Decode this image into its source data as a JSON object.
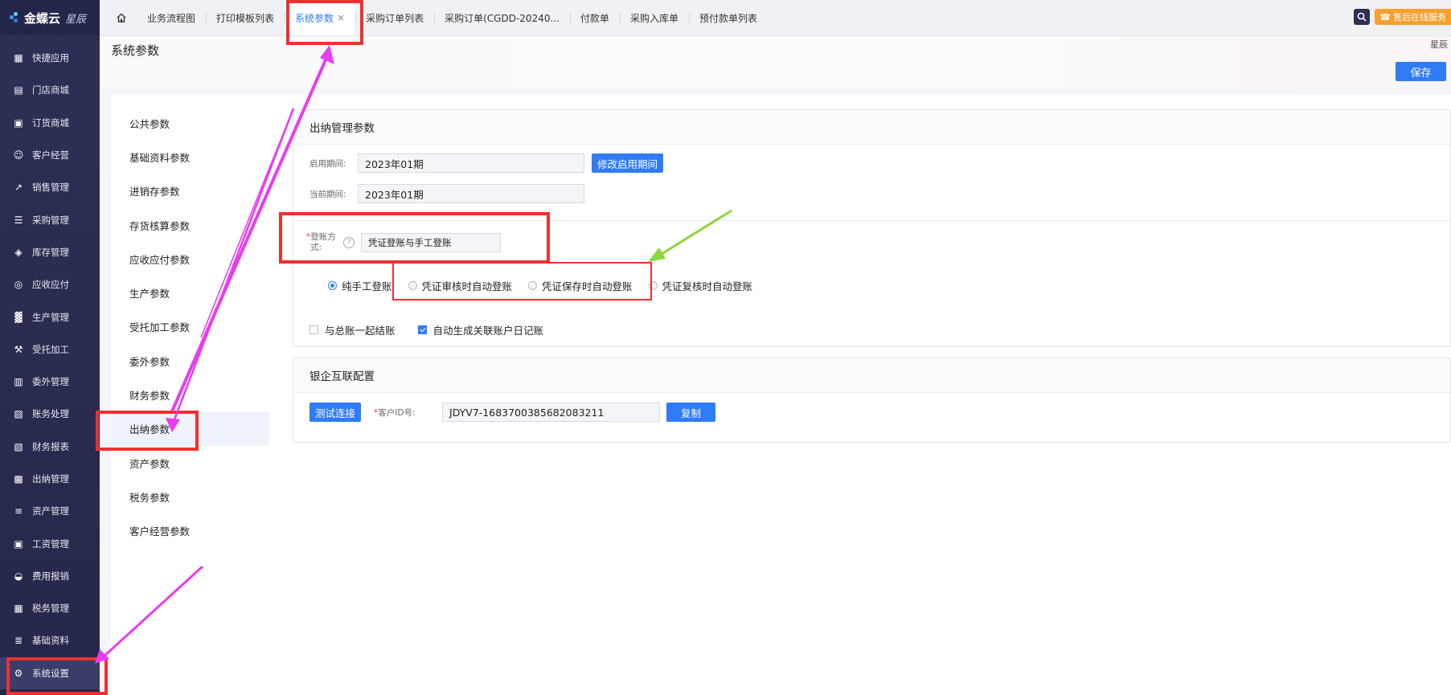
{
  "sidebar": {
    "logo": "金蝶云",
    "logo_sub": "星辰",
    "items": [
      {
        "label": "快捷应用",
        "icon": "apps-icon"
      },
      {
        "label": "门店商城",
        "icon": "store-icon"
      },
      {
        "label": "订货商城",
        "icon": "cart-bag-icon"
      },
      {
        "label": "客户经营",
        "icon": "customer-icon"
      },
      {
        "label": "销售管理",
        "icon": "sales-icon"
      },
      {
        "label": "采购管理",
        "icon": "purchase-icon"
      },
      {
        "label": "库存管理",
        "icon": "inventory-icon"
      },
      {
        "label": "应收应付",
        "icon": "receivable-icon"
      },
      {
        "label": "生产管理",
        "icon": "factory-icon"
      },
      {
        "label": "受托加工",
        "icon": "tools-icon"
      },
      {
        "label": "委外管理",
        "icon": "outsource-icon"
      },
      {
        "label": "账务处理",
        "icon": "accounting-icon"
      },
      {
        "label": "财务报表",
        "icon": "report-icon"
      },
      {
        "label": "出纳管理",
        "icon": "cashier-icon"
      },
      {
        "label": "资产管理",
        "icon": "asset-icon"
      },
      {
        "label": "工资管理",
        "icon": "salary-icon"
      },
      {
        "label": "费用报销",
        "icon": "expense-icon"
      },
      {
        "label": "税务管理",
        "icon": "tax-icon"
      },
      {
        "label": "基础资料",
        "icon": "layers-icon"
      },
      {
        "label": "系统设置",
        "icon": "gear-icon"
      }
    ]
  },
  "topbar": {
    "tabs": [
      {
        "label": "业务流程图"
      },
      {
        "label": "打印模板列表"
      },
      {
        "label": "系统参数",
        "active": true
      },
      {
        "label": "采购订单列表"
      },
      {
        "label": "采购订单(CGDD-20240..."
      },
      {
        "label": "付款单"
      },
      {
        "label": "采购入库单"
      },
      {
        "label": "预付款单列表"
      }
    ],
    "close_symbol": "×",
    "service_label": "售后在线服务"
  },
  "header": {
    "title": "系统参数",
    "corner_label": "星辰",
    "save_label": "保存"
  },
  "subnav": {
    "items": [
      {
        "label": "公共参数"
      },
      {
        "label": "基础资料参数"
      },
      {
        "label": "进销存参数"
      },
      {
        "label": "存货核算参数"
      },
      {
        "label": "应收应付参数"
      },
      {
        "label": "生产参数"
      },
      {
        "label": "受托加工参数"
      },
      {
        "label": "委外参数"
      },
      {
        "label": "财务参数"
      },
      {
        "label": "出纳参数",
        "active": true
      },
      {
        "label": "资产参数"
      },
      {
        "label": "税务参数"
      },
      {
        "label": "客户经营参数"
      }
    ]
  },
  "cashier_section": {
    "title": "出纳管理参数",
    "start_period_label": "启用期间:",
    "start_period_value": "2023年01期",
    "modify_button": "修改启用期间",
    "current_period_label": "当前期间:",
    "current_period_value": "2023年01期",
    "posting_label": "登账方式:",
    "posting_label_line1": "登账方",
    "posting_label_line2": "式:",
    "help_symbol": "?",
    "posting_value": "凭证登账与手工登账",
    "radios": [
      {
        "label": "纯手工登账",
        "checked": true
      },
      {
        "label": "凭证审核时自动登账",
        "checked": false
      },
      {
        "label": "凭证保存时自动登账",
        "checked": false
      },
      {
        "label": "凭证复核时自动登账",
        "checked": false
      }
    ],
    "checkboxes": [
      {
        "label": "与总账一起结账",
        "checked": false
      },
      {
        "label": "自动生成关联账户日记账",
        "checked": true
      }
    ]
  },
  "bank_section": {
    "title": "银企互联配置",
    "test_button": "测试连接",
    "customer_id_label": "客户ID号:",
    "customer_id_value": "JDYV7-1683700385682083211",
    "copy_button": "复制"
  },
  "colors": {
    "sidebar_bg": "#2b2d52",
    "accent": "#2f7cf6",
    "annotation_red": "#f0302f",
    "annotation_magenta": "#e83cf0",
    "annotation_green": "#8fd63a"
  }
}
